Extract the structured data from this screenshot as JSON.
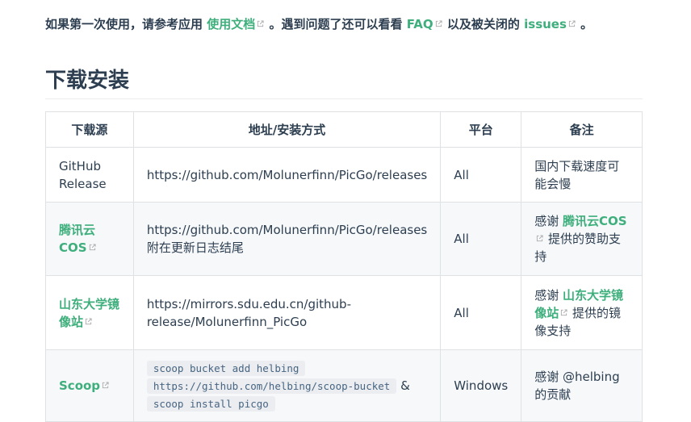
{
  "intro": {
    "t1": "如果第一次使用，请参考应用",
    "doc_link": "使用文档",
    "t2": "。遇到问题了还可以看看",
    "faq_link": "FAQ",
    "t3": "以及被关闭的",
    "issues_link": "issues",
    "t4": "。"
  },
  "section_title": "下载安装",
  "table": {
    "headers": [
      "下载源",
      "地址/安装方式",
      "平台",
      "备注"
    ],
    "rows": [
      {
        "source": "GitHub Release",
        "address": "https://github.com/Molunerfinn/PicGo/releases",
        "platform": "All",
        "note": "国内下载速度可能会慢"
      },
      {
        "source": "腾讯云COS",
        "address_line1": "https://github.com/Molunerfinn/PicGo/releases",
        "address_line2": "附在更新日志结尾",
        "platform": "All",
        "note_prefix": "感谢",
        "note_link": "腾讯云COS",
        "note_suffix": "提供的赞助支持"
      },
      {
        "source": "山东大学镜像站",
        "address": "https://mirrors.sdu.edu.cn/github-release/Molunerfinn_PicGo",
        "platform": "All",
        "note_prefix": "感谢",
        "note_link": "山东大学镜像站",
        "note_suffix": "提供的镜像支持"
      },
      {
        "source": "Scoop",
        "code1": "scoop bucket add helbing",
        "code2": "https://github.com/helbing/scoop-bucket",
        "amp": "&",
        "code3": "scoop install picgo",
        "platform": "Windows",
        "note": "感谢 @helbing 的贡献"
      }
    ]
  },
  "colors": {
    "link": "#3eaf7c",
    "text": "#2c3e50",
    "border": "#dfe2e5",
    "alt_row": "#f6f8fa"
  },
  "icons": [
    "external-link-icon"
  ]
}
